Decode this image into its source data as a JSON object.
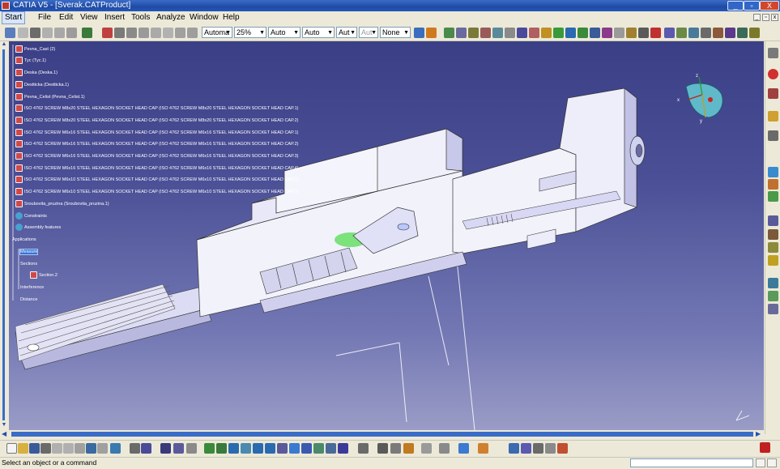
{
  "window": {
    "title": "CATIA V5 - [Sverak.CATProduct]",
    "minimize_label": "_",
    "maximize_label": "▫",
    "close_label": "X"
  },
  "menu": [
    "Start",
    "File",
    "Edit",
    "View",
    "Insert",
    "Tools",
    "Analyze",
    "Window",
    "Help"
  ],
  "toolbar": {
    "render_mode": "Automa",
    "zoom": "25%",
    "combo_auto1": "Auto",
    "combo_auto2": "Auto",
    "combo_aut3": "Aut",
    "combo_aut4": "Aut",
    "combo_none": "None"
  },
  "tree": {
    "items": [
      {
        "label": "Pevna_Cast (2)",
        "icon": "part-icon"
      },
      {
        "label": "Tyc (Tyc.1)",
        "icon": "part-icon"
      },
      {
        "label": "Deska (Deska.1)",
        "icon": "part-icon"
      },
      {
        "label": "Destticka (Destticka.1)",
        "icon": "part-icon"
      },
      {
        "label": "Pevna_Celist (Pevna_Celist.1)",
        "icon": "part-icon"
      },
      {
        "label": "ISO 4762 SCREW M8x20 STEEL HEXAGON SOCKET HEAD CAP (ISO 4762 SCREW M8x20 STEEL HEXAGON SOCKET HEAD CAP.1)",
        "icon": "part-icon"
      },
      {
        "label": "ISO 4762 SCREW M8x20 STEEL HEXAGON SOCKET HEAD CAP (ISO 4762 SCREW M8x20 STEEL HEXAGON SOCKET HEAD CAP.2)",
        "icon": "part-icon"
      },
      {
        "label": "ISO 4762 SCREW M6x16 STEEL HEXAGON SOCKET HEAD CAP (ISO 4762 SCREW M6x16 STEEL HEXAGON SOCKET HEAD CAP.1)",
        "icon": "part-icon"
      },
      {
        "label": "ISO 4762 SCREW M6x16 STEEL HEXAGON SOCKET HEAD CAP (ISO 4762 SCREW M6x16 STEEL HEXAGON SOCKET HEAD CAP.2)",
        "icon": "part-icon"
      },
      {
        "label": "ISO 4762 SCREW M6x16 STEEL HEXAGON SOCKET HEAD CAP (ISO 4762 SCREW M6x16 STEEL HEXAGON SOCKET HEAD CAP.3)",
        "icon": "part-icon"
      },
      {
        "label": "ISO 4762 SCREW M6x16 STEEL HEXAGON SOCKET HEAD CAP (ISO 4762 SCREW M6x16 STEEL HEXAGON SOCKET HEAD CAP.4)",
        "icon": "part-icon"
      },
      {
        "label": "ISO 4762 SCREW M6x10 STEEL HEXAGON SOCKET HEAD CAP (ISO 4762 SCREW M6x10 STEEL HEXAGON SOCKET HEAD CAP.1)",
        "icon": "part-icon"
      },
      {
        "label": "ISO 4762 SCREW M6x10 STEEL HEXAGON SOCKET HEAD CAP (ISO 4762 SCREW M6x10 STEEL HEXAGON SOCKET HEAD CAP.2)",
        "icon": "part-icon"
      },
      {
        "label": "Sroubovita_pruzina (Sroubovita_pruzina.1)",
        "icon": "part-icon"
      },
      {
        "label": "Constraints",
        "icon": "constraints-icon"
      },
      {
        "label": "Assembly features",
        "icon": "gear-icon"
      },
      {
        "label": "Applications",
        "icon": "app-icon"
      },
      {
        "label": "Measure",
        "icon": "measure-icon",
        "selected": true
      },
      {
        "label": "Sections",
        "icon": "app-icon"
      },
      {
        "label": "Section.2",
        "icon": "section-icon"
      },
      {
        "label": "Interference",
        "icon": "app-icon"
      },
      {
        "label": "Distance",
        "icon": "app-icon"
      }
    ]
  },
  "compass": {
    "x_label": "x",
    "y_label": "y",
    "z_label": "z"
  },
  "status": {
    "message": "Select an object or a command"
  },
  "colors": {
    "title_bar": "#2457b8",
    "viewport_top": "#3b3f86",
    "viewport_bottom": "#9a9cc6",
    "model_face": "#f2f2fb",
    "model_shade": "#c6c6ea",
    "selection": "#3875d7"
  }
}
